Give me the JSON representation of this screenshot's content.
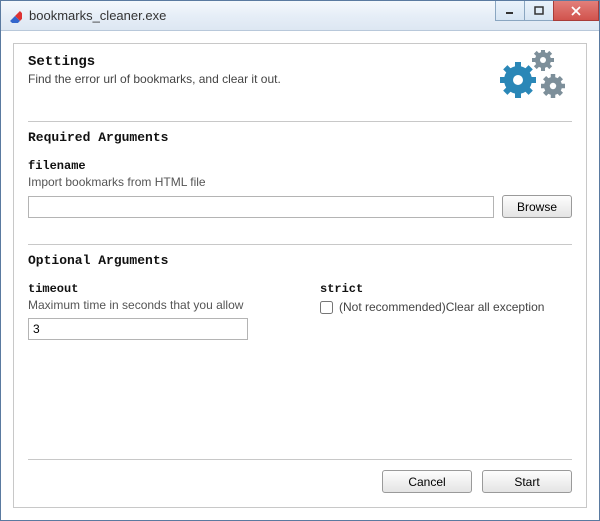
{
  "window": {
    "title": "bookmarks_cleaner.exe"
  },
  "header": {
    "title": "Settings",
    "subtitle": "Find the error url of bookmarks, and clear it out."
  },
  "sections": {
    "required": {
      "title": "Required Arguments",
      "filename": {
        "label": "filename",
        "desc": "Import bookmarks from HTML file",
        "value": "",
        "browse_btn": "Browse"
      }
    },
    "optional": {
      "title": "Optional Arguments",
      "timeout": {
        "label": "timeout",
        "desc": "Maximum time in seconds that you allow",
        "value": "3"
      },
      "strict": {
        "label": "strict",
        "check_label": "(Not recommended)Clear all exception",
        "checked": false
      }
    }
  },
  "footer": {
    "cancel": "Cancel",
    "start": "Start"
  }
}
